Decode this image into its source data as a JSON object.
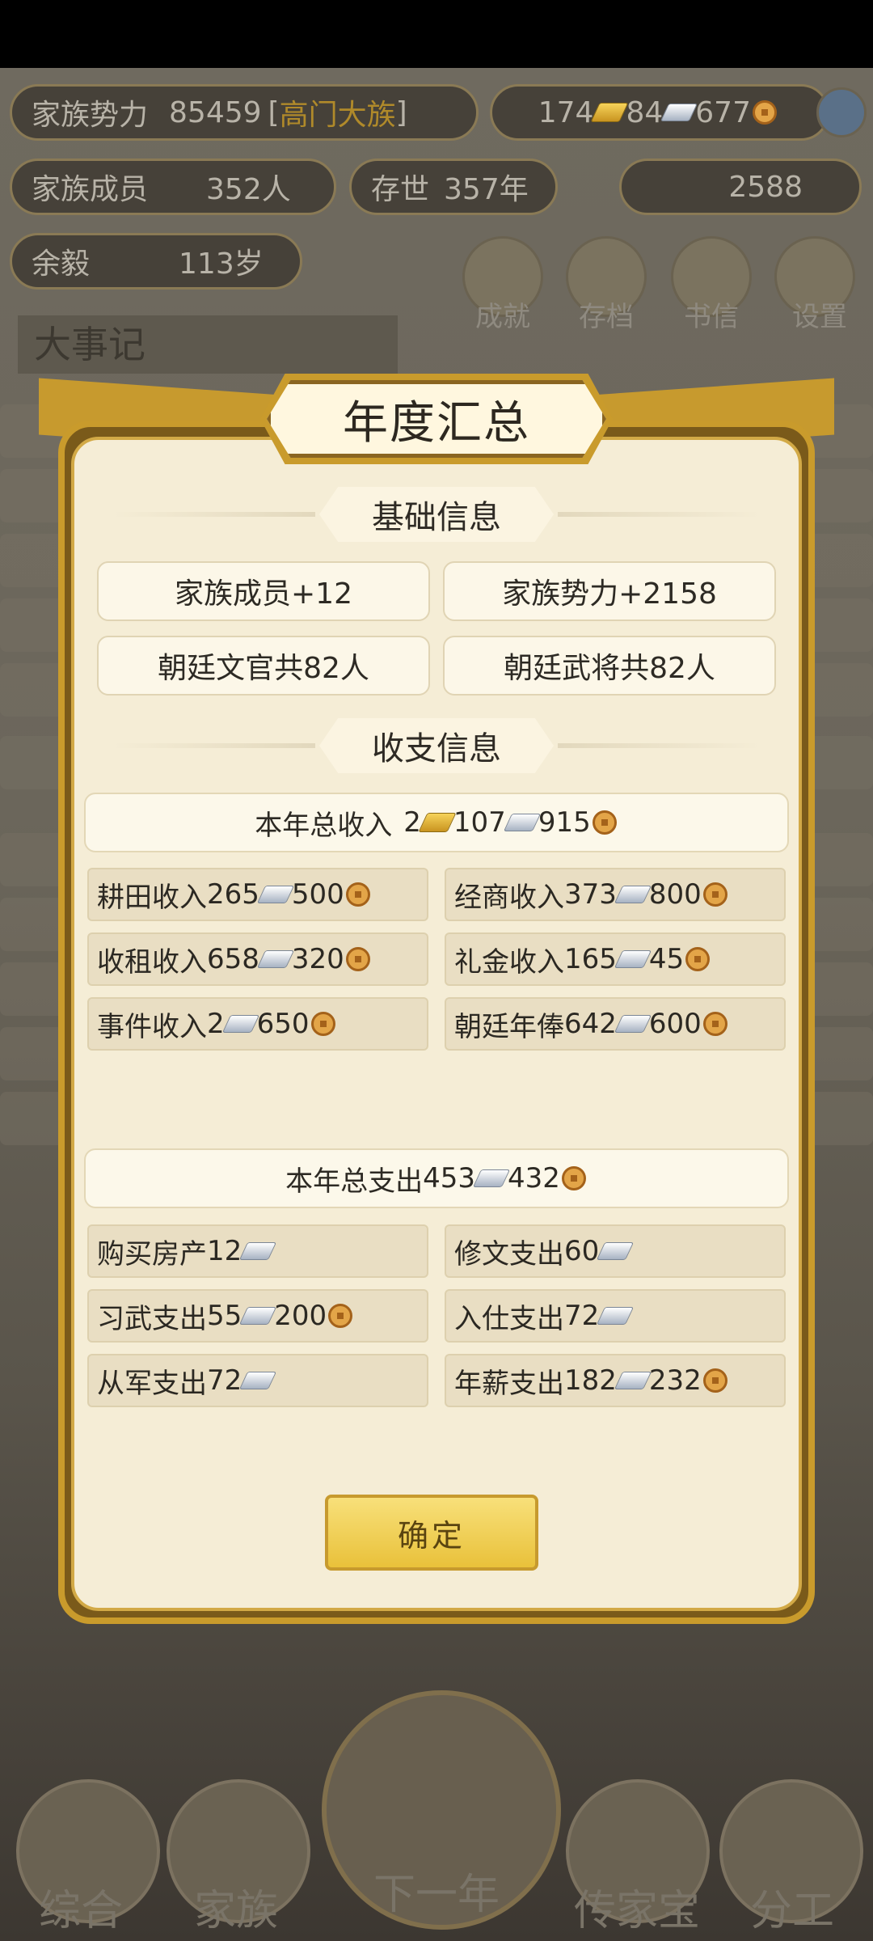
{
  "hud": {
    "family_power_label": "家族势力",
    "family_power_value": "85459",
    "family_rank": "高门大族",
    "res_gold": "174",
    "res_silver": "84",
    "res_coin": "677",
    "members_label": "家族成员",
    "members_value": "352人",
    "survival_label": "存世",
    "survival_value": "357年",
    "ingot_value": "2588",
    "elder_label": "余毅",
    "elder_value": "113岁"
  },
  "shortcuts": [
    "成就",
    "存档",
    "书信",
    "设置"
  ],
  "events_title": "大事记",
  "modal": {
    "title": "年度汇总",
    "basic_section": "基础信息",
    "basic": [
      "家族成员+12",
      "家族势力+2158",
      "朝廷文官共82人",
      "朝廷武将共82人"
    ],
    "finance_section": "收支信息",
    "income_total": {
      "label": "本年总收入",
      "gold": "2",
      "silver": "107",
      "coin": "915"
    },
    "income_items": [
      {
        "label": "耕田收入",
        "silver": "265",
        "coin": "500"
      },
      {
        "label": "经商收入",
        "silver": "373",
        "coin": "800"
      },
      {
        "label": "收租收入",
        "silver": "658",
        "coin": "320"
      },
      {
        "label": "礼金收入",
        "silver": "165",
        "coin": "45"
      },
      {
        "label": "事件收入",
        "silver": "2",
        "coin": "650"
      },
      {
        "label": "朝廷年俸",
        "silver": "642",
        "coin": "600"
      }
    ],
    "expense_total": {
      "label": "本年总支出",
      "silver": "453",
      "coin": "432"
    },
    "expense_items": [
      {
        "label": "购买房产",
        "silver": "12",
        "coin": ""
      },
      {
        "label": "修文支出",
        "silver": "60",
        "coin": ""
      },
      {
        "label": "习武支出",
        "silver": "55",
        "coin": "200"
      },
      {
        "label": "入仕支出",
        "silver": "72",
        "coin": ""
      },
      {
        "label": "从军支出",
        "silver": "72",
        "coin": ""
      },
      {
        "label": "年薪支出",
        "silver": "182",
        "coin": "232"
      }
    ],
    "confirm_label": "确定"
  },
  "bottom_nav": [
    "综合",
    "家族",
    "下一年",
    "传家宝",
    "分工"
  ]
}
